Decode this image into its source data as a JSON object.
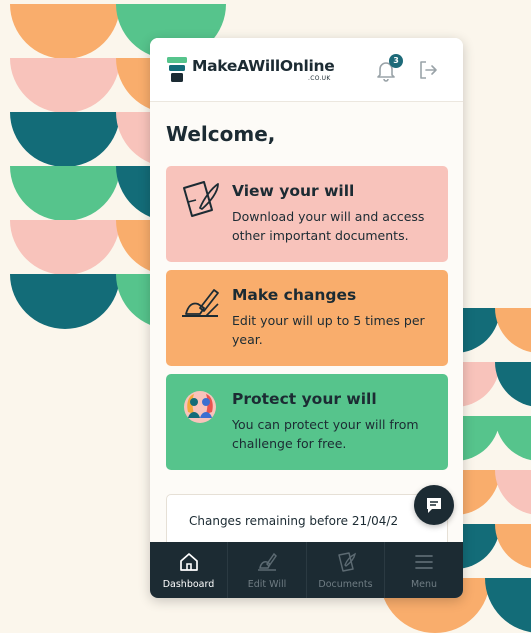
{
  "colors": {
    "teal": "#136c78",
    "green": "#56c48c",
    "orange": "#f9ad6c",
    "pink": "#f8c3bb",
    "dark": "#1c2b33",
    "background": "#fbf6ec"
  },
  "header": {
    "brand": "MakeAWillOnline",
    "brand_suffix": ".CO.UK",
    "notification_count": "3",
    "icons": [
      "logo-icon",
      "bell-icon",
      "logout-icon"
    ]
  },
  "welcome": "Welcome,",
  "cards": [
    {
      "title": "View your will",
      "description": "Download your will and access other important documents.",
      "icon": "document-pen-icon"
    },
    {
      "title": "Make changes",
      "description": "Edit your will up to 5 times per year.",
      "icon": "hand-writing-icon"
    },
    {
      "title": "Protect your will",
      "description": "You can protect your will  from challenge for free.",
      "icon": "shield-people-icon"
    }
  ],
  "changes_remaining": "Changes remaining before 21/04/2",
  "nav": [
    {
      "label": "Dashboard",
      "icon": "home-icon",
      "active": true
    },
    {
      "label": "Edit Will",
      "icon": "edit-will-icon",
      "active": false
    },
    {
      "label": "Documents",
      "icon": "documents-icon",
      "active": false
    },
    {
      "label": "Menu",
      "icon": "menu-icon",
      "active": false
    }
  ]
}
